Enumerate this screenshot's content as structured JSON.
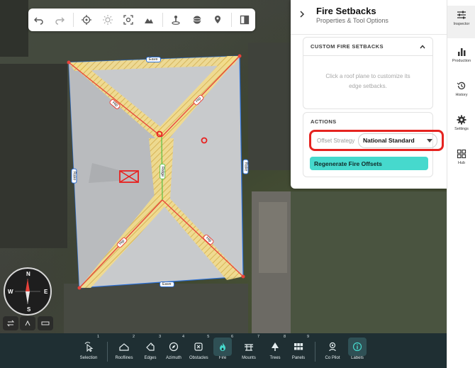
{
  "toolbar": {
    "icons": [
      "undo-icon",
      "redo-icon",
      "target-icon",
      "sun-icon",
      "focus-icon",
      "mountain-icon",
      "person-pin-icon",
      "sphere-icon",
      "map-pin-icon",
      "split-view-icon"
    ]
  },
  "roof": {
    "labels": {
      "top": "Eave",
      "bottom": "Eave",
      "left": "Rake",
      "right": "Rake",
      "center": "Ridge",
      "hip_ne": "Hip",
      "hip_nw": "Hip",
      "hip_se": "Hip",
      "hip_sw": "Hip"
    }
  },
  "panel": {
    "title": "Fire Setbacks",
    "subtitle": "Properties & Tool Options",
    "custom_header": "CUSTOM FIRE SETBACKS",
    "custom_placeholder_1": "Click a roof plane to customize its",
    "custom_placeholder_2": "edge setbacks.",
    "actions_header": "ACTIONS",
    "offset_label": "Offset Strategy",
    "offset_value": "National Standard",
    "regenerate_label": "Regenerate Fire Offsets"
  },
  "rail": {
    "items": [
      {
        "label": "Inspector"
      },
      {
        "label": "Production"
      },
      {
        "label": "History"
      },
      {
        "label": "Settings"
      },
      {
        "label": "Hub"
      }
    ]
  },
  "bottom_toolbar": {
    "tools": [
      {
        "label": "Selection",
        "num": "1"
      },
      {
        "label": "Rooflines",
        "num": "2"
      },
      {
        "label": "Edges",
        "num": "3"
      },
      {
        "label": "Azimuth",
        "num": "4"
      },
      {
        "label": "Obstacles",
        "num": "5"
      },
      {
        "label": "Fire",
        "num": "6"
      },
      {
        "label": "Mounts",
        "num": "7"
      },
      {
        "label": "Trees",
        "num": "8"
      },
      {
        "label": "Panels",
        "num": "9"
      },
      {
        "label": "Co Pilot",
        "num": ""
      },
      {
        "label": "Labels",
        "num": ""
      }
    ]
  },
  "compass": {
    "n": "N",
    "s": "S",
    "e": "E",
    "w": "W"
  },
  "colors": {
    "accent": "#46d9cd",
    "highlight": "#e52320",
    "setback": "#f2d36b",
    "bottom_bar": "#1f2f33"
  }
}
